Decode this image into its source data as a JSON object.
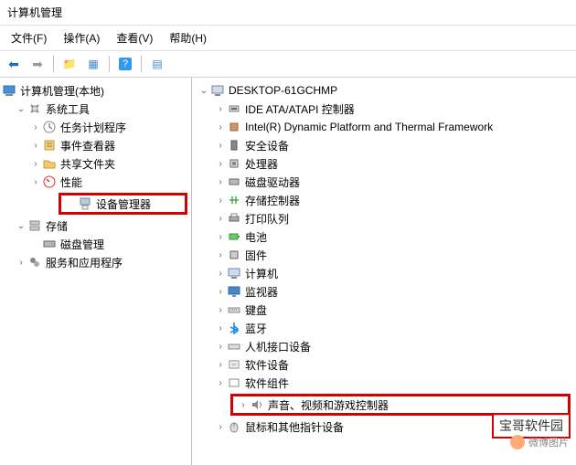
{
  "title": "计算机管理",
  "menu": {
    "file": "文件(F)",
    "action": "操作(A)",
    "view": "查看(V)",
    "help": "帮助(H)"
  },
  "left": {
    "root": "计算机管理(本地)",
    "system_tools": "系统工具",
    "task_scheduler": "任务计划程序",
    "event_viewer": "事件查看器",
    "shared_folders": "共享文件夹",
    "performance": "性能",
    "device_manager": "设备管理器",
    "storage": "存储",
    "disk_mgmt": "磁盘管理",
    "services_apps": "服务和应用程序"
  },
  "right": {
    "computer": "DESKTOP-61GCHMP",
    "items": {
      "ide": "IDE ATA/ATAPI 控制器",
      "intel": "Intel(R) Dynamic Platform and Thermal Framework",
      "security": "安全设备",
      "processors": "处理器",
      "disk_drives": "磁盘驱动器",
      "storage_ctrl": "存储控制器",
      "print_queues": "打印队列",
      "batteries": "电池",
      "firmware": "固件",
      "computers": "计算机",
      "monitors": "监视器",
      "keyboards": "键盘",
      "bluetooth": "蓝牙",
      "hid": "人机接口设备",
      "sw_devices": "软件设备",
      "sw_components": "软件组件",
      "sound": "声音、视频和游戏控制器",
      "mouse": "鼠标和其他指针设备"
    }
  },
  "watermark": {
    "text": "宝哥软件园",
    "sub": "微博图片"
  }
}
